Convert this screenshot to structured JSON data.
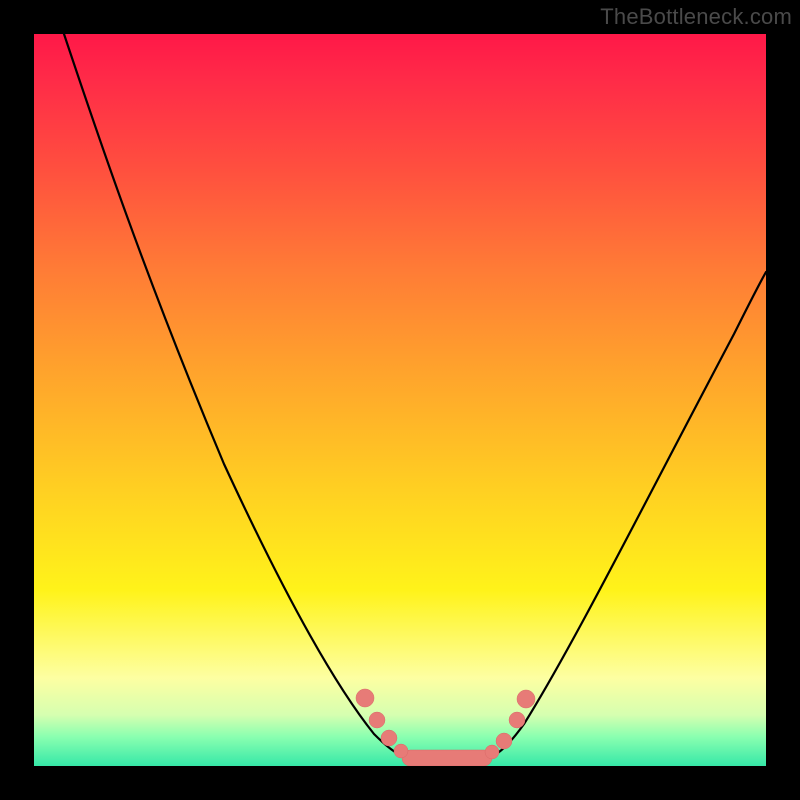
{
  "watermark": "TheBottleneck.com",
  "colors": {
    "frame": "#000000",
    "curve": "#000000",
    "marker": "#e77b77",
    "gradient_stops": [
      "#ff1848",
      "#ff2a48",
      "#ff4e3f",
      "#ff7b36",
      "#ffa32c",
      "#ffcf22",
      "#fff31a",
      "#fdffa2",
      "#d6ffb0",
      "#8affb0",
      "#36e8a8"
    ]
  },
  "chart_data": {
    "type": "line",
    "title": "",
    "xlabel": "",
    "ylabel": "",
    "xlim": [
      0,
      100
    ],
    "ylim": [
      0,
      100
    ],
    "note": "V-shaped bottleneck curve; y≈0 at the flat valley, rising steeply on both sides. x is normalized component-ratio axis, y is bottleneck %.",
    "series": [
      {
        "name": "bottleneck-curve",
        "x": [
          0,
          5,
          10,
          15,
          20,
          25,
          30,
          35,
          40,
          45,
          48,
          50,
          52,
          55,
          58,
          60,
          63,
          65,
          70,
          75,
          80,
          85,
          90,
          95,
          100
        ],
        "y": [
          100,
          92,
          83,
          73,
          63,
          53,
          43,
          33,
          23,
          13,
          6,
          2,
          0,
          0,
          0,
          0,
          2,
          6,
          14,
          22,
          31,
          40,
          49,
          58,
          67
        ]
      }
    ],
    "markers": {
      "name": "highlight-dots",
      "x": [
        44.5,
        46,
        47.5,
        50,
        53,
        56,
        59,
        61,
        62.5,
        64
      ],
      "y": [
        10,
        7,
        4,
        1,
        0.5,
        0.5,
        1,
        3,
        6,
        9
      ]
    },
    "valley_bar": {
      "x_start": 50,
      "x_end": 60,
      "y": 0.5,
      "height": 2.5
    }
  }
}
